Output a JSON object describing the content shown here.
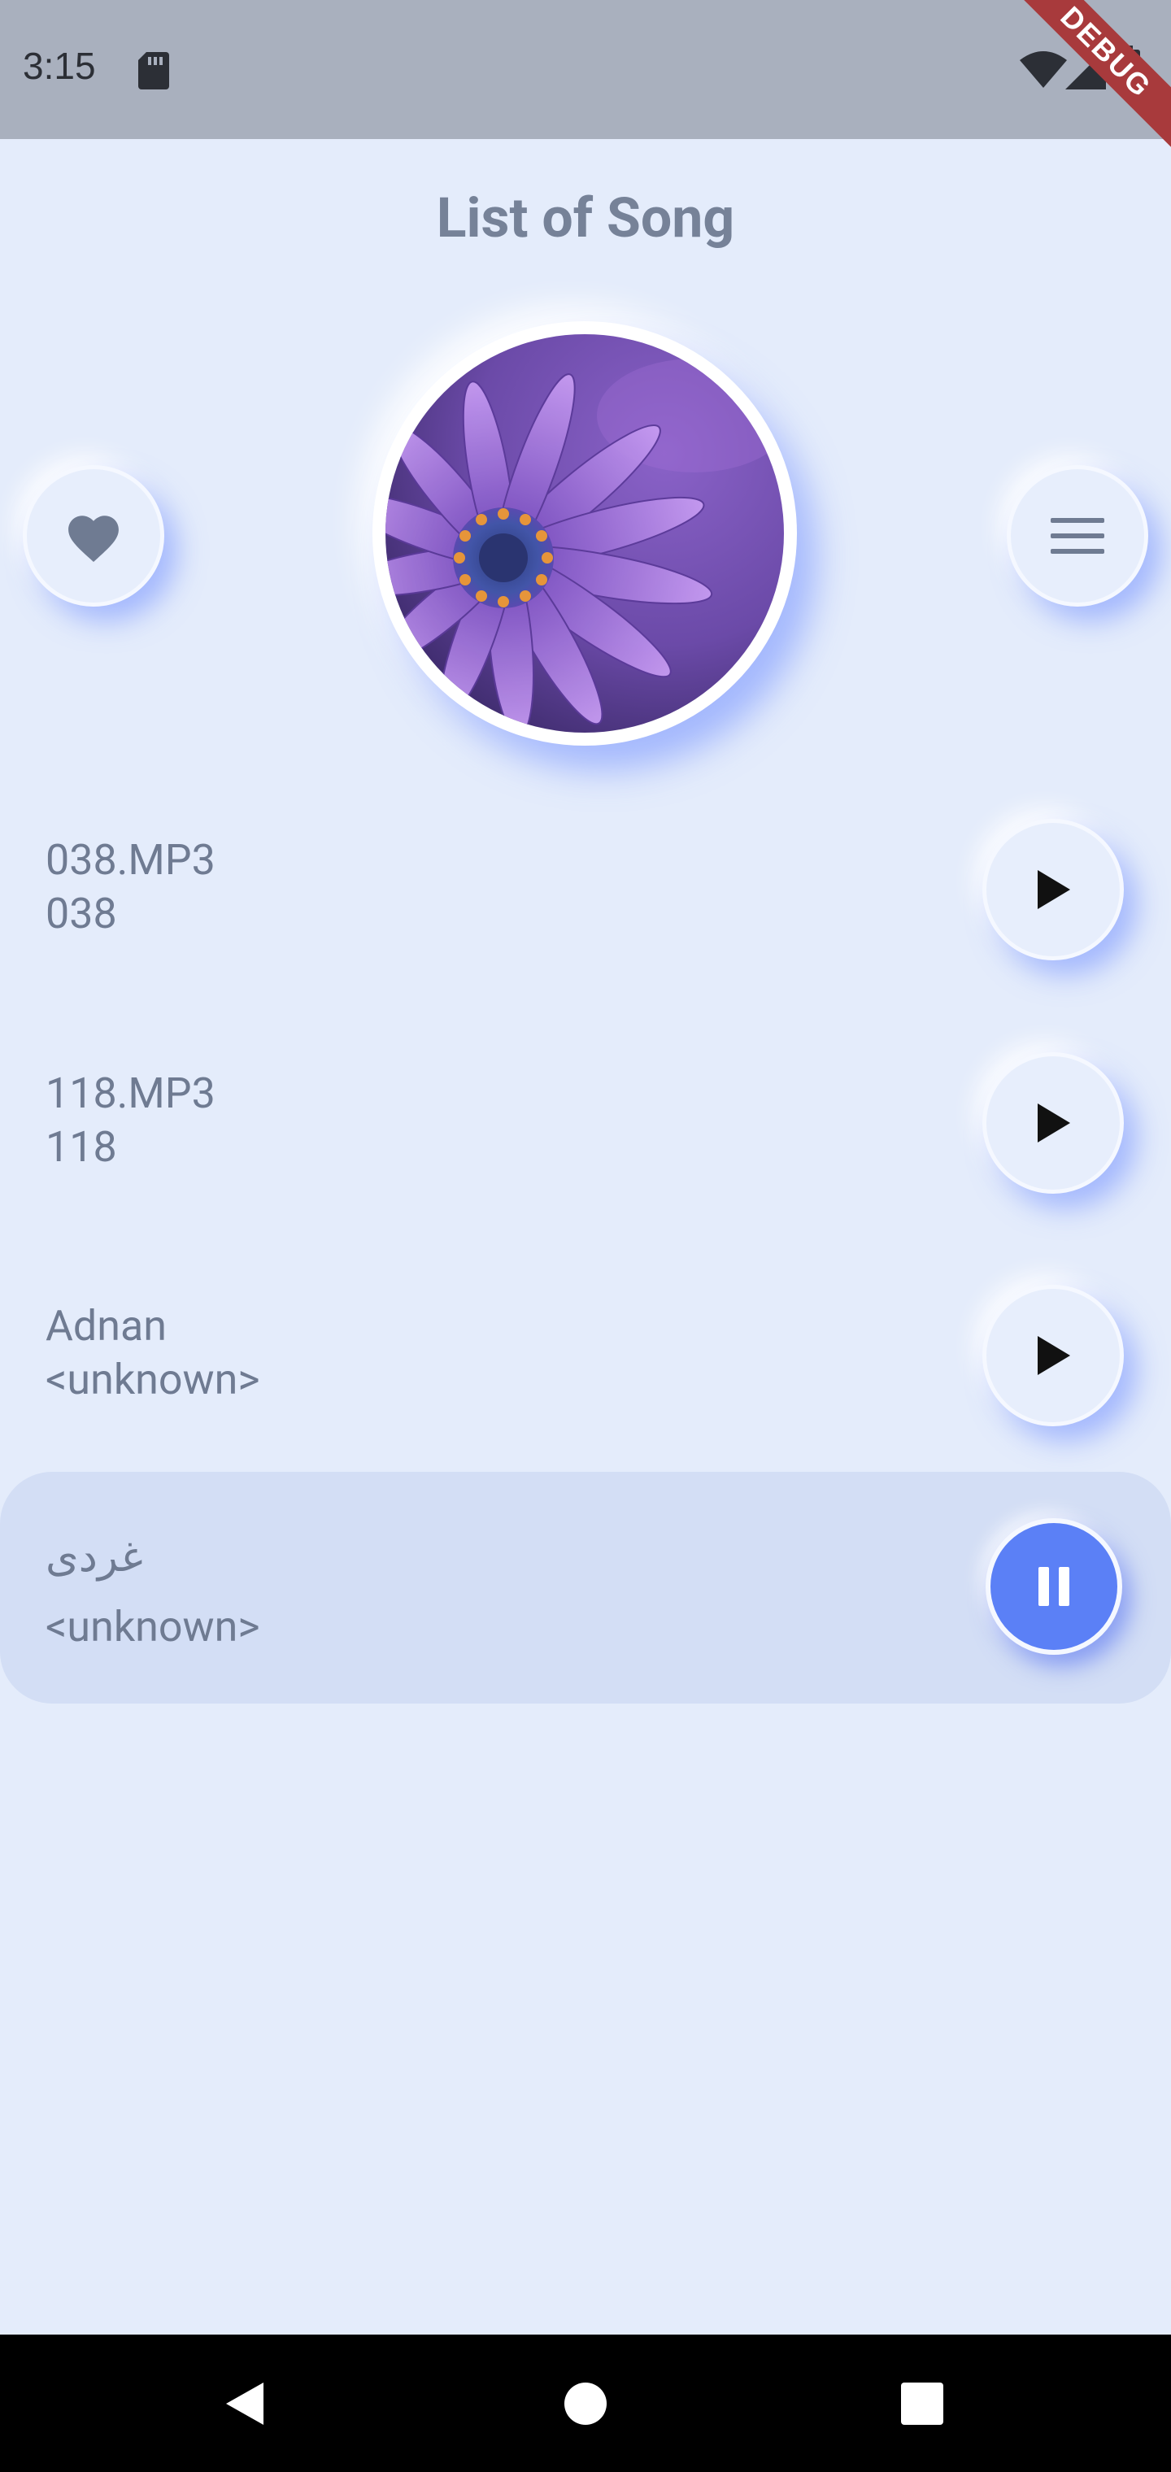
{
  "status_bar": {
    "time": "3:15",
    "icons": [
      "sd-card-icon",
      "wifi-icon",
      "signal-icon",
      "battery-icon"
    ]
  },
  "debug_banner": "DEBUG",
  "header": {
    "title": "List of Song"
  },
  "controls": {
    "favorite_icon": "heart-icon",
    "menu_icon": "menu-icon"
  },
  "album_art": {
    "description_icon": "album-art"
  },
  "songs": [
    {
      "title": "038.MP3",
      "artist": "038",
      "state": "stopped",
      "control_icon": "play-icon"
    },
    {
      "title": "118.MP3",
      "artist": "118",
      "state": "stopped",
      "control_icon": "play-icon"
    },
    {
      "title": "Adnan",
      "artist": "<unknown>",
      "state": "stopped",
      "control_icon": "play-icon"
    },
    {
      "title": "غردی",
      "artist": "<unknown>",
      "state": "playing",
      "control_icon": "pause-icon"
    }
  ],
  "colors": {
    "background": "#e4ecfb",
    "accent": "#5b80f6",
    "text": "#6f7b92",
    "title": "#768298",
    "active_row": "#d3def5"
  },
  "nav_bar": {
    "icons": [
      "back-icon",
      "home-icon",
      "recents-icon"
    ]
  }
}
